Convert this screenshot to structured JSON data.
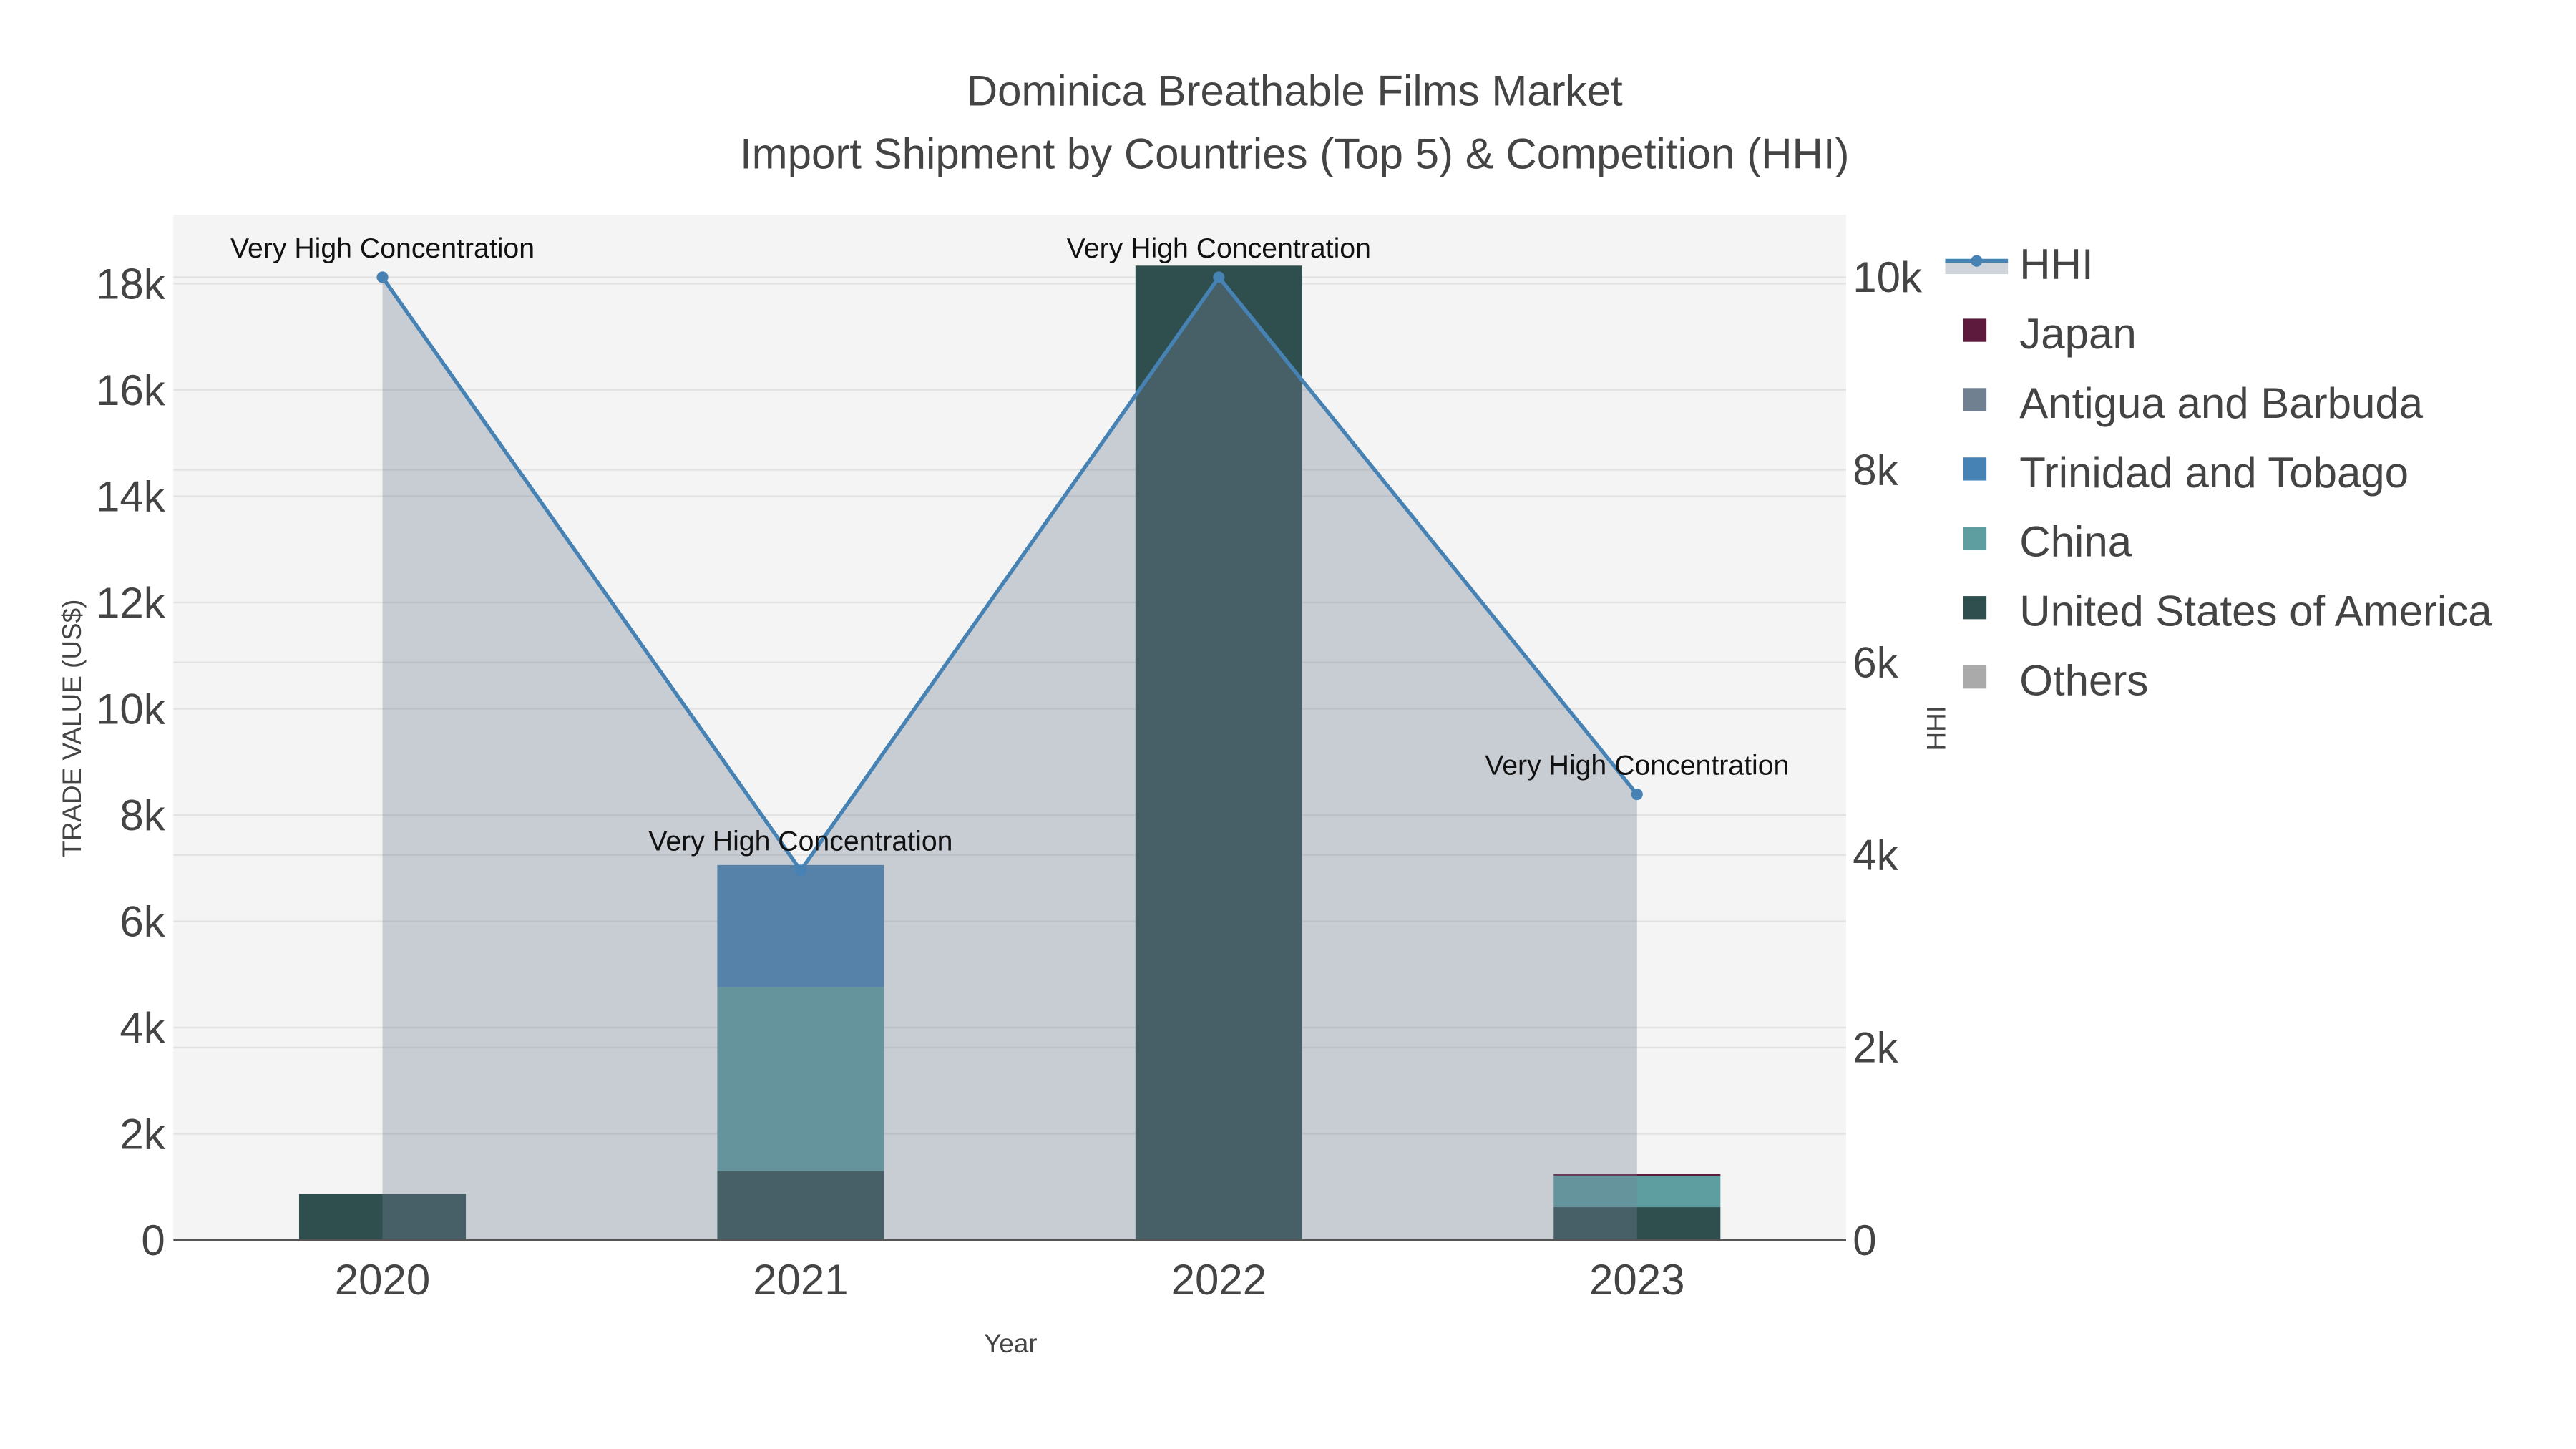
{
  "chart_data": {
    "type": "bar",
    "title": "Dominica Breathable Films Market",
    "subtitle": "Import Shipment by Countries (Top 5) & Competition (HHI)",
    "xlabel": "Year",
    "ylabel": "TRADE VALUE (US$)",
    "y2label": "HHI",
    "categories": [
      "2020",
      "2021",
      "2022",
      "2023"
    ],
    "ylim": [
      0,
      19300
    ],
    "yticks": [
      0,
      2000,
      4000,
      6000,
      8000,
      10000,
      12000,
      14000,
      16000,
      18000
    ],
    "ytick_labels": [
      "0",
      "2k",
      "4k",
      "6k",
      "8k",
      "10k",
      "12k",
      "14k",
      "16k",
      "18k"
    ],
    "y2lim": [
      0,
      10650
    ],
    "y2ticks": [
      0,
      2000,
      4000,
      6000,
      8000,
      10000
    ],
    "y2tick_labels": [
      "0",
      "2k",
      "4k",
      "6k",
      "8k",
      "10k"
    ],
    "grid": true,
    "legend_position": "right",
    "series": [
      {
        "name": "United States of America",
        "color": "#2f4f4f",
        "values": [
          870,
          1300,
          18340,
          620
        ]
      },
      {
        "name": "China",
        "color": "#5f9ea0",
        "values": [
          0,
          3460,
          0,
          590
        ]
      },
      {
        "name": "Trinidad and Tobago",
        "color": "#4682b4",
        "values": [
          0,
          2300,
          0,
          0
        ]
      },
      {
        "name": "Antigua and Barbuda",
        "color": "#708090",
        "values": [
          0,
          0,
          0,
          0
        ]
      },
      {
        "name": "Japan",
        "color": "#5e1a3c",
        "values": [
          0,
          0,
          0,
          40
        ]
      },
      {
        "name": "Others",
        "color": "#aaaaaa",
        "values": [
          0,
          0,
          0,
          0
        ]
      }
    ],
    "hhi": {
      "name": "HHI",
      "color": "#4682b4",
      "values": [
        10000,
        3840,
        10000,
        4630
      ]
    },
    "annotations": [
      "Very High Concentration",
      "Very High Concentration",
      "Very High Concentration",
      "Very High Concentration"
    ],
    "legend_order": [
      "HHI",
      "Japan",
      "Antigua and Barbuda",
      "Trinidad and Tobago",
      "China",
      "United States of America",
      "Others"
    ]
  }
}
